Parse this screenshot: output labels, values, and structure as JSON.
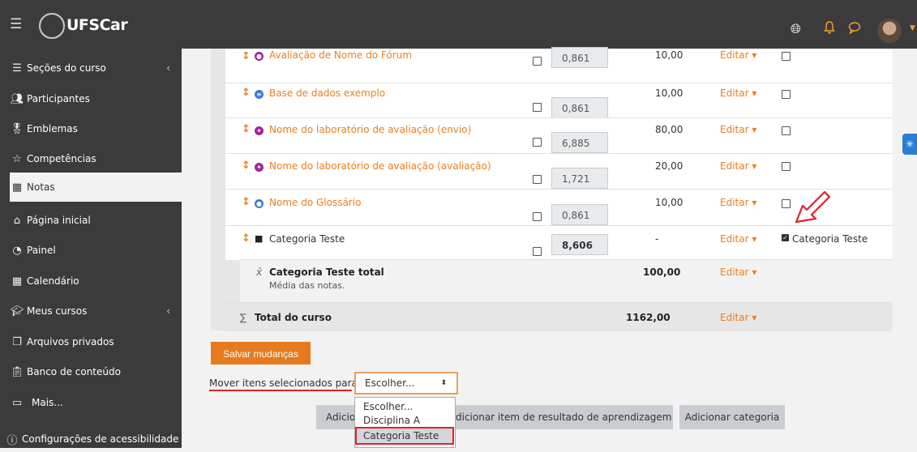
{
  "header": {
    "logo_text": "UFSCar",
    "menu_icon": "hamburger-icon"
  },
  "sidebar": {
    "items": [
      {
        "label": "Seções do curso",
        "icon": "list-icon"
      },
      {
        "label": "Participantes",
        "icon": "people-icon"
      },
      {
        "label": "Emblemas",
        "icon": "badge-icon"
      },
      {
        "label": "Competências",
        "icon": "star-icon"
      },
      {
        "label": "Notas",
        "icon": "table-icon"
      },
      {
        "label": "Página inicial",
        "icon": "home-icon"
      },
      {
        "label": "Painel",
        "icon": "gauge-icon"
      },
      {
        "label": "Calendário",
        "icon": "calendar-icon"
      },
      {
        "label": "Meus cursos",
        "icon": "graduation-icon"
      },
      {
        "label": "Arquivos privados",
        "icon": "files-icon"
      },
      {
        "label": "Banco de conteúdo",
        "icon": "clipboard-icon"
      },
      {
        "label": "Mais...",
        "icon": "folder-icon"
      },
      {
        "label": "Configurações de acessibilidade",
        "icon": "accessibility-icon"
      }
    ]
  },
  "grades": {
    "items": [
      {
        "name": "Avaliação de Nome do Fórum",
        "weight": "0,861",
        "max": "10,00",
        "edit": "Editar"
      },
      {
        "name": "Base de dados exemplo",
        "weight": "0,861",
        "max": "10,00",
        "edit": "Editar"
      },
      {
        "name": "Nome do laboratório de avaliação (envio)",
        "weight": "6,885",
        "max": "80,00",
        "edit": "Editar"
      },
      {
        "name": "Nome do laboratório de avaliação (avaliação)",
        "weight": "1,721",
        "max": "20,00",
        "edit": "Editar"
      },
      {
        "name": "Nome do Glossário",
        "weight": "0,861",
        "max": "10,00",
        "edit": "Editar"
      },
      {
        "name": "Categoria Teste",
        "weight": "8,606",
        "max": "-",
        "edit": "Editar",
        "select_label": "Categoria Teste"
      }
    ],
    "category_total": {
      "name": "Categoria Teste total",
      "sub": "Média das notas.",
      "max": "100,00",
      "edit": "Editar"
    },
    "course_total": {
      "name": "Total do curso",
      "max": "1162,00",
      "edit": "Editar"
    }
  },
  "actions": {
    "save_label": "Salvar mudanças",
    "move_label": "Mover itens selecionados para",
    "select_value": "Escolher...",
    "options": [
      "Escolher...",
      "Disciplina A",
      "Categoria Teste"
    ],
    "add_item_label": "Adicionar item de nota",
    "add_item_visible": "Adicio",
    "add_outcome_label": "Adicionar item de resultado de aprendizagem",
    "add_outcome_visible": "dicionar item de resultado de aprendizagem",
    "add_category_label": "Adicionar categoria"
  },
  "colors": {
    "accent": "#e8801e",
    "sidebar": "#3b3b3b",
    "highlight": "#e1222a"
  }
}
